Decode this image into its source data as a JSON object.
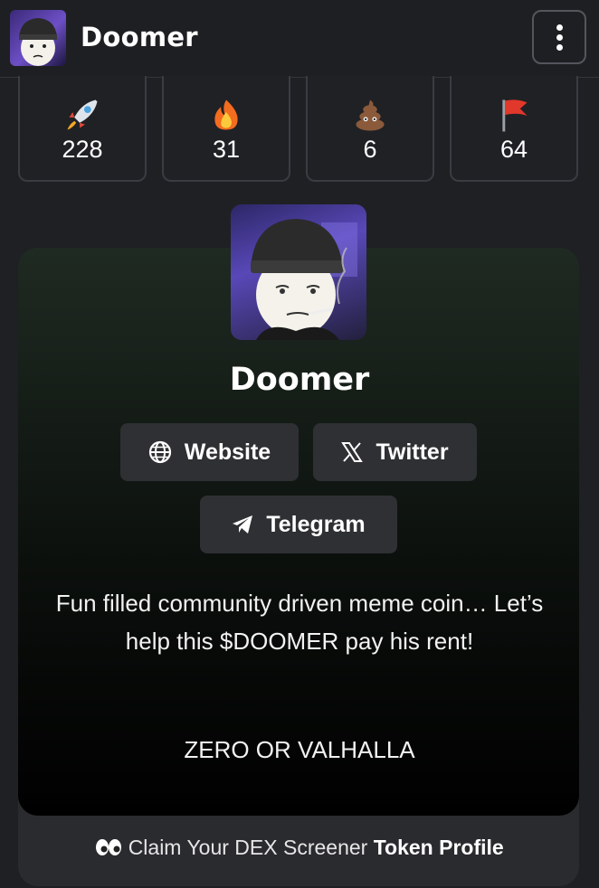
{
  "header": {
    "title": "Doomer",
    "logo_icon": "doomer-avatar",
    "menu_icon": "vertical-dots-icon"
  },
  "reactions": [
    {
      "icon": "rocket-icon",
      "count": "228"
    },
    {
      "icon": "fire-icon",
      "count": "31"
    },
    {
      "icon": "poop-icon",
      "count": "6"
    },
    {
      "icon": "red-flag-icon",
      "count": "64"
    }
  ],
  "token": {
    "name": "Doomer",
    "links": {
      "website": "Website",
      "twitter": "Twitter",
      "telegram": "Telegram"
    },
    "description": "Fun filled community driven meme coin… Let’s help this $DOOMER pay his rent!",
    "tagline": "ZERO OR VALHALLA"
  },
  "claim": {
    "prefix_icon": "eyes-icon",
    "text": "Claim Your DEX Screener",
    "bold": "Token Profile"
  },
  "colors": {
    "background": "#1f2024",
    "card_top": "#1f2a22",
    "button": "#2f3033"
  }
}
